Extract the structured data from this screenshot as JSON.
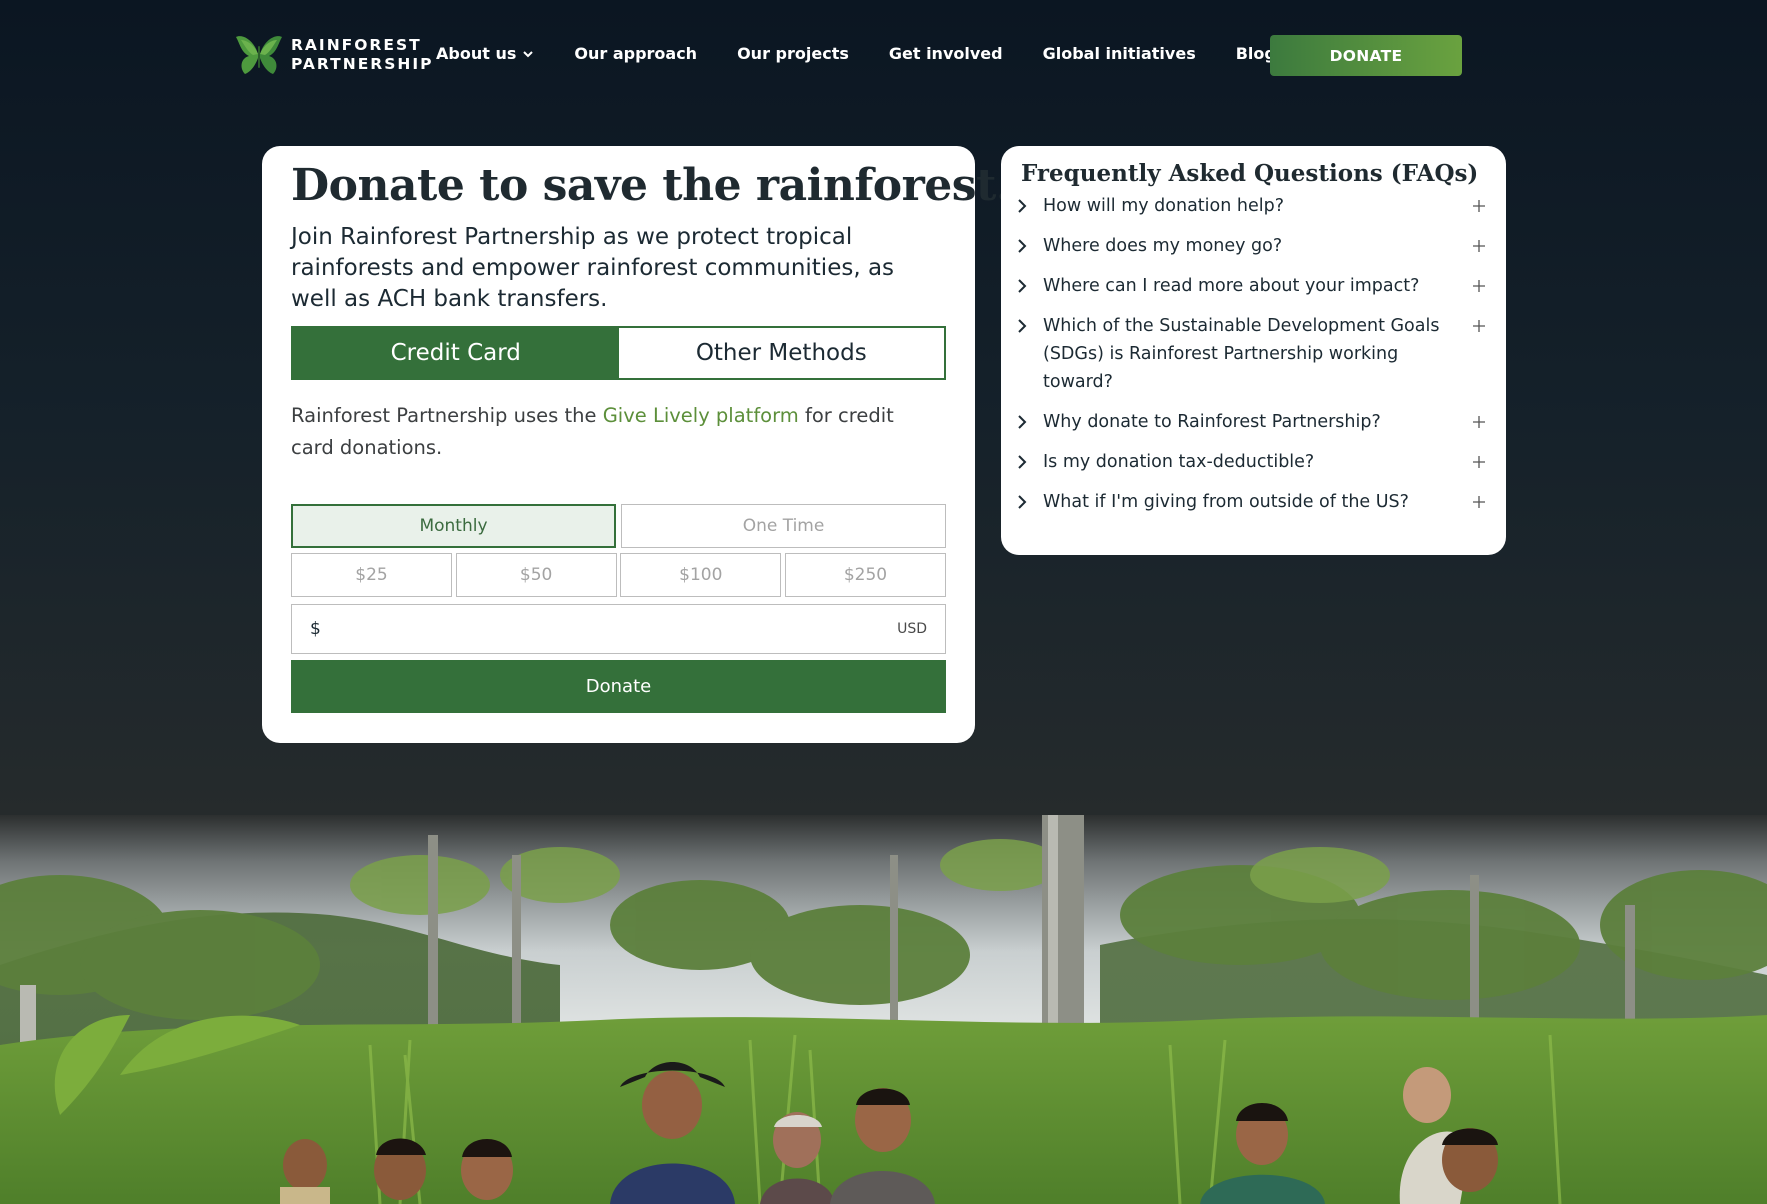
{
  "brand": {
    "line1": "RAINFOREST",
    "line2": "PARTNERSHIP",
    "accent": "#5a9a3c"
  },
  "nav": {
    "items": [
      {
        "label": "About us",
        "has_dropdown": true
      },
      {
        "label": "Our approach"
      },
      {
        "label": "Our projects"
      },
      {
        "label": "Get involved"
      },
      {
        "label": "Global initiatives"
      },
      {
        "label": "Blog"
      }
    ],
    "donate_label": "DONATE"
  },
  "donation": {
    "title": "Donate to save the rainforest.",
    "subtitle": "Join Rainforest Partnership as we protect tropical rainforests and empower rainforest communities, as well as ACH bank transfers.",
    "tabs": [
      {
        "label": "Credit Card",
        "active": true
      },
      {
        "label": "Other Methods",
        "active": false
      }
    ],
    "note_prefix": "Rainforest Partnership uses the ",
    "note_link": "Give Lively platform",
    "note_suffix": " for credit card donations.",
    "frequency": [
      {
        "label": "Monthly",
        "selected": true
      },
      {
        "label": "One Time",
        "selected": false
      }
    ],
    "amounts": [
      "$25",
      "$50",
      "$100",
      "$250"
    ],
    "currency_symbol": "$",
    "amount_value": "",
    "currency_code": "USD",
    "submit_label": "Donate",
    "primary_color": "#34703a"
  },
  "faq": {
    "title": "Frequently Asked Questions (FAQs)",
    "items": [
      "How will my donation help?",
      "Where does my money go?",
      "Where can I read more about your impact?",
      "Which of the Sustainable Development Goals (SDGs) is Rainforest Partnership working toward?",
      "Why donate to Rainforest Partnership?",
      "Is my donation tax-deductible?",
      "What if I'm giving from outside of the US?"
    ]
  }
}
